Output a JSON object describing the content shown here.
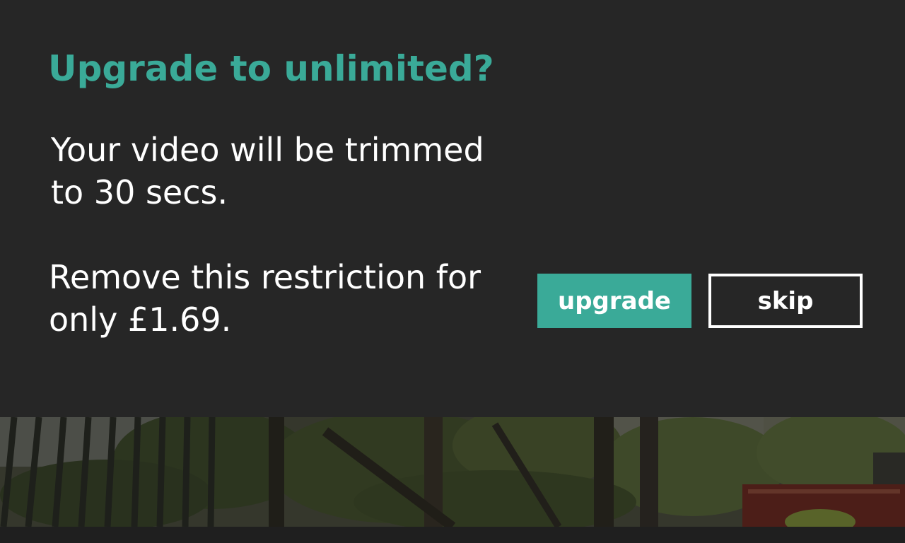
{
  "dialog": {
    "title": "Upgrade to unlimited?",
    "message_line1": "Your video will be trimmed",
    "message_line2": "to 30 secs.",
    "offer_line1": "Remove this restriction for",
    "offer_line2": "only £1.69.",
    "upgrade_label": "upgrade",
    "skip_label": "skip"
  },
  "colors": {
    "accent": "#3aaa98",
    "background": "#262626",
    "text": "#ffffff"
  }
}
